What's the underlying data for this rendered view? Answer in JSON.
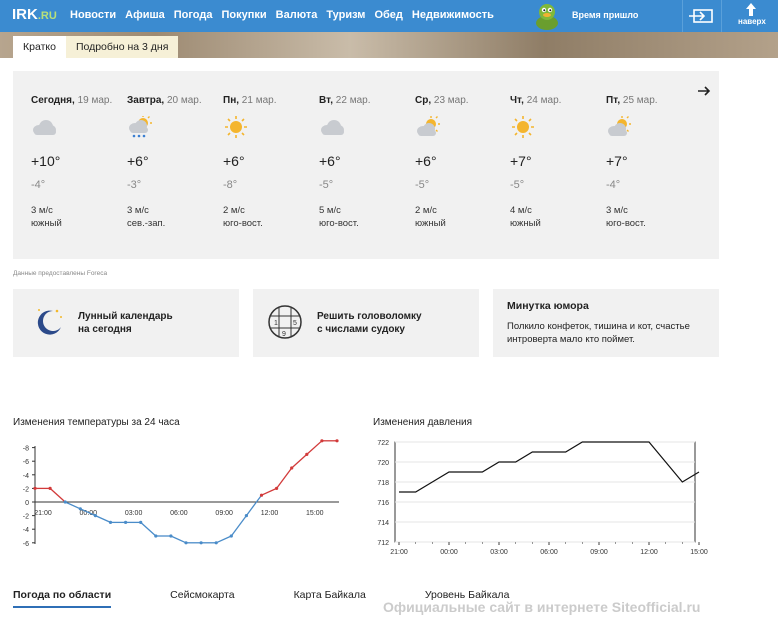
{
  "nav": {
    "logo": "IRK",
    "logo_suffix": ".RU",
    "links": [
      "Новости",
      "Афиша",
      "Погода",
      "Покупки",
      "Валюта",
      "Туризм",
      "Обед",
      "Недвижимость"
    ],
    "active": "Погода",
    "time_text": "Время пришло",
    "up_label": "наверх",
    "accent": "#3b8bd0"
  },
  "tabs": [
    "Кратко",
    "Подробно на 3 дня"
  ],
  "forecast": {
    "days": [
      {
        "name": "Сегодня,",
        "date": "19 мар.",
        "icon": "cloud-icon",
        "tmax": "+10°",
        "tmin": "-4°",
        "wind": "3 м/с",
        "dir": "южный"
      },
      {
        "name": "Завтра,",
        "date": "20 мар.",
        "icon": "sun-cloud-snow-icon",
        "tmax": "+6°",
        "tmin": "-3°",
        "wind": "3 м/с",
        "dir": "сев.-зап."
      },
      {
        "name": "Пн,",
        "date": "21 мар.",
        "icon": "sun-icon",
        "tmax": "+6°",
        "tmin": "-8°",
        "wind": "2 м/с",
        "dir": "юго-вост."
      },
      {
        "name": "Вт,",
        "date": "22 мар.",
        "icon": "cloud-icon",
        "tmax": "+6°",
        "tmin": "-5°",
        "wind": "5 м/с",
        "dir": "юго-вост."
      },
      {
        "name": "Ср,",
        "date": "23 мар.",
        "icon": "sun-cloud-icon",
        "tmax": "+6°",
        "tmin": "-5°",
        "wind": "2 м/с",
        "dir": "южный"
      },
      {
        "name": "Чт,",
        "date": "24 мар.",
        "icon": "sun-icon",
        "tmax": "+7°",
        "tmin": "-5°",
        "wind": "4 м/с",
        "dir": "южный"
      },
      {
        "name": "Пт,",
        "date": "25 мар.",
        "icon": "sun-cloud-icon",
        "tmax": "+7°",
        "tmin": "-4°",
        "wind": "3 м/с",
        "dir": "юго-вост."
      }
    ],
    "credit": "Данные предоставлены Foreca"
  },
  "cards": {
    "moon": {
      "line1": "Лунный календарь",
      "line2": "на сегодня"
    },
    "sudoku": {
      "line1": "Решить головоломку",
      "line2": "с числами судоку"
    },
    "joke": {
      "title": "Минутка юмора",
      "line1": "Полкило конфеток, тишина и кот, счастье",
      "line2": "интроверта мало кто поймет."
    }
  },
  "temp_chart": {
    "title": "Изменения температуры за 24 часа"
  },
  "press_chart": {
    "title": "Изменения давления"
  },
  "chart_data": [
    {
      "type": "line",
      "title": "Изменения температуры за 24 часа",
      "x_ticks": [
        "21:00",
        "00:00",
        "03:00",
        "06:00",
        "09:00",
        "12:00",
        "15:00"
      ],
      "y_ticks": [
        "-8",
        "-6",
        "-4",
        "-2",
        "0",
        "-2",
        "-4",
        "-6"
      ],
      "ylim": [
        -6,
        9
      ],
      "colors": {
        "warm": "#d23a3a",
        "cold": "#4a8cc9"
      },
      "series": [
        {
          "values": [
            2,
            2,
            0,
            -1,
            -2,
            -3,
            -3,
            -3,
            -5,
            -5,
            -6,
            -6,
            -6,
            -5,
            -2,
            1,
            2,
            5,
            7,
            9,
            9
          ]
        }
      ]
    },
    {
      "type": "line",
      "title": "Изменения давления",
      "x_ticks": [
        "21:00",
        "00:00",
        "03:00",
        "06:00",
        "09:00",
        "12:00",
        "15:00"
      ],
      "y_ticks": [
        "722",
        "720",
        "718",
        "716",
        "714",
        "712"
      ],
      "ylim": [
        712,
        722
      ],
      "grid": true,
      "series": [
        {
          "x": [
            21,
            22,
            23,
            24,
            25,
            26,
            27,
            28,
            29,
            30,
            31,
            32,
            33,
            34,
            35,
            36,
            37,
            38,
            39
          ],
          "values": [
            717,
            717,
            718,
            719,
            719,
            719,
            720,
            720,
            721,
            721,
            721,
            722,
            722,
            722,
            722,
            722,
            720,
            718,
            719
          ]
        }
      ]
    }
  ],
  "bottom_tabs": [
    "Погода по области",
    "Сейсмокарта",
    "Карта Байкала",
    "Уровень Байкала"
  ],
  "watermark": "Официальные сайт в интернете Siteofficial.ru"
}
